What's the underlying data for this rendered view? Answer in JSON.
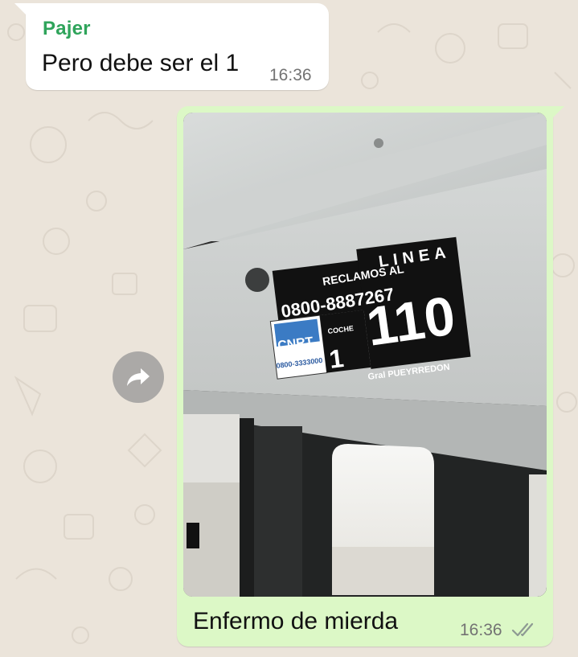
{
  "incoming_message": {
    "sender": "Pajer",
    "text": "Pero debe ser el 1",
    "time": "16:36"
  },
  "outgoing_message": {
    "caption": "Enfermo de mierda",
    "time": "16:36",
    "status_icon": "double-check-icon"
  },
  "photo_sign": {
    "reclamos": "RECLAMOS AL",
    "phone": "0800-8887267",
    "cnrt": "CNRT",
    "cnrt_phone": "0800-3333000",
    "coche_label": "COCHE",
    "coche_number": "1",
    "linea_label": "LINEA",
    "linea_number": "110",
    "city": "Gral PUEYRREDON"
  },
  "forward_button": {
    "icon": "forward-icon"
  },
  "colors": {
    "sender_name": "#2fa45b",
    "outgoing_bubble": "#dcf8c6",
    "incoming_bubble": "#ffffff",
    "chat_background": "#ebe4da"
  }
}
